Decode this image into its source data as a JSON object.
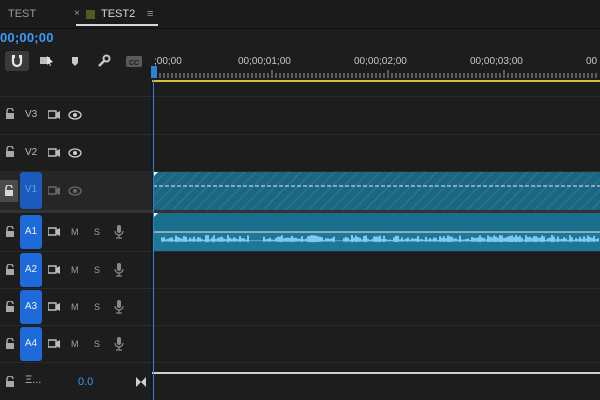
{
  "tabs": [
    {
      "label": "TEST"
    },
    {
      "label": "TEST2",
      "close": "×",
      "menu": "≡",
      "swatch_color": "#4b5d22"
    }
  ],
  "timecode": "00;00;00",
  "tools": [
    "snap-icon",
    "linked-selection-icon",
    "add-marker-icon",
    "wrench-icon",
    "captions-icon"
  ],
  "tools_cc_label": "CC",
  "ruler": {
    "labels": [
      ";00;00",
      "00;00;01;00",
      "00;00;02;00",
      "00;00;03;00",
      "00"
    ]
  },
  "video_tracks": [
    {
      "name": "V3",
      "target": false
    },
    {
      "name": "V2",
      "target": false
    },
    {
      "name": "V1",
      "target": true
    }
  ],
  "audio_tracks": [
    {
      "name": "A1",
      "m": "M",
      "s": "S"
    },
    {
      "name": "A2",
      "m": "M",
      "s": "S"
    },
    {
      "name": "A3",
      "m": "M",
      "s": "S"
    },
    {
      "name": "A4",
      "m": "M",
      "s": "S"
    }
  ],
  "mix": {
    "name": "Ξ...",
    "value": "0.0"
  },
  "colors": {
    "accent": "#3b9bf7",
    "clip_video": "#1d6680",
    "clip_audio": "#1a6f8c",
    "waveform": "#7fc9f0",
    "work_area": "#d4c43a"
  }
}
